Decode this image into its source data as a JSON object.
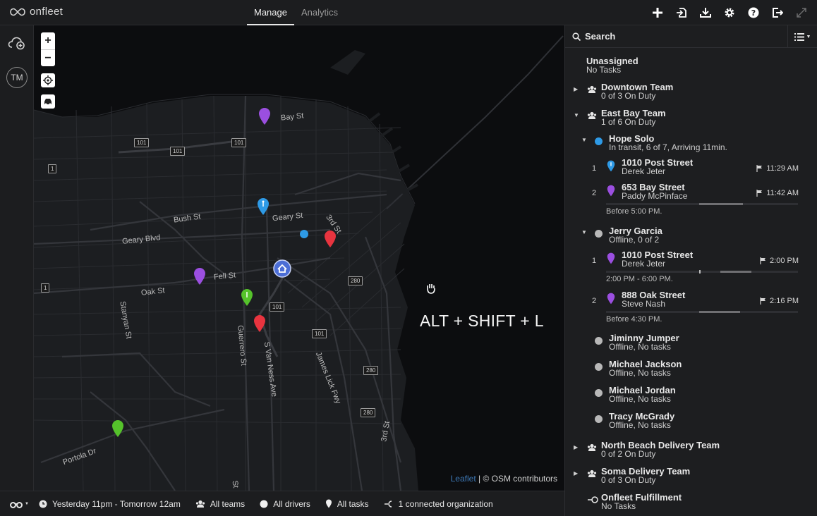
{
  "app": {
    "logo_text": "onfleet"
  },
  "nav": {
    "tabs": [
      "Manage",
      "Analytics"
    ],
    "active": "Manage"
  },
  "toolbar": {
    "icons": [
      "plus-icon",
      "import-icon",
      "download-icon",
      "gear-icon",
      "help-icon",
      "logout-icon",
      "fullscreen-icon"
    ]
  },
  "rail": {
    "avatar_initials": "TM"
  },
  "map": {
    "streets": [
      "Bay St",
      "Bush St",
      "Geary St",
      "Geary Blvd",
      "3rd St",
      "Fell St",
      "Oak St",
      "Stanyan St",
      "Guerrero St",
      "S Van Ness Ave",
      "James Lick Fwy",
      "3rd St",
      "Portola Dr",
      "St"
    ],
    "shields": [
      "101",
      "101",
      "101",
      "1",
      "280",
      "101",
      "101",
      "1",
      "280",
      "280"
    ],
    "overlay_text": "ALT + SHIFT + L",
    "attribution_link": "Leaflet",
    "attribution_text": "| © OSM contributors",
    "pin_colors": {
      "purple": "#9b4fe0",
      "blue": "#2e9ae6",
      "red": "#e8343f",
      "green": "#55c22b",
      "hub": "#4c6ed6"
    }
  },
  "panel": {
    "search_label": "Search",
    "unassigned": {
      "name": "Unassigned",
      "sub": "No Tasks"
    },
    "teams": [
      {
        "name": "Downtown Team",
        "sub": "0 of 3 On Duty"
      },
      {
        "name": "East Bay Team",
        "sub": "1 of 6 On Duty"
      },
      {
        "name": "North Beach Delivery Team",
        "sub": "0 of 2 On Duty"
      },
      {
        "name": "Soma Delivery Team",
        "sub": "0 of 3 On Duty"
      },
      {
        "name": "Onfleet Fulfillment",
        "sub": "No Tasks"
      }
    ],
    "drivers": [
      {
        "name": "Hope Solo",
        "sub": "In transit, 6 of 7, Arriving 11min.",
        "color": "#2e9ae6"
      },
      {
        "name": "Jerry Garcia",
        "sub": "Offline, 0 of 2",
        "color": "#b8b8b8"
      },
      {
        "name": "Jiminny Jumper",
        "sub": "Offline, No tasks",
        "color": "#b8b8b8"
      },
      {
        "name": "Michael Jackson",
        "sub": "Offline, No tasks",
        "color": "#b8b8b8"
      },
      {
        "name": "Michael Jordan",
        "sub": "Offline, No tasks",
        "color": "#b8b8b8"
      },
      {
        "name": "Tracy McGrady",
        "sub": "Offline, No tasks",
        "color": "#b8b8b8"
      }
    ],
    "tasks": [
      {
        "num": "1",
        "address": "1010 Post Street",
        "person": "Derek Jeter",
        "time": "11:29 AM",
        "pin": "#2e9ae6"
      },
      {
        "num": "2",
        "address": "653 Bay Street",
        "person": "Paddy McPinface",
        "time": "11:42 AM",
        "pin": "#9b4fe0"
      },
      {
        "num": "1",
        "address": "1010 Post Street",
        "person": "Derek Jeter",
        "time": "2:00 PM",
        "pin": "#9b4fe0"
      },
      {
        "num": "2",
        "address": "888 Oak Street",
        "person": "Steve Nash",
        "time": "2:16 PM",
        "pin": "#9b4fe0"
      }
    ],
    "windows": [
      "Before 5:00 PM.",
      "2:00 PM - 6:00 PM.",
      "Before 4:30 PM."
    ]
  },
  "bottom": {
    "time_range": "Yesterday 11pm - Tomorrow 12am",
    "teams": "All teams",
    "drivers": "All drivers",
    "tasks": "All tasks",
    "orgs": "1 connected organization"
  }
}
